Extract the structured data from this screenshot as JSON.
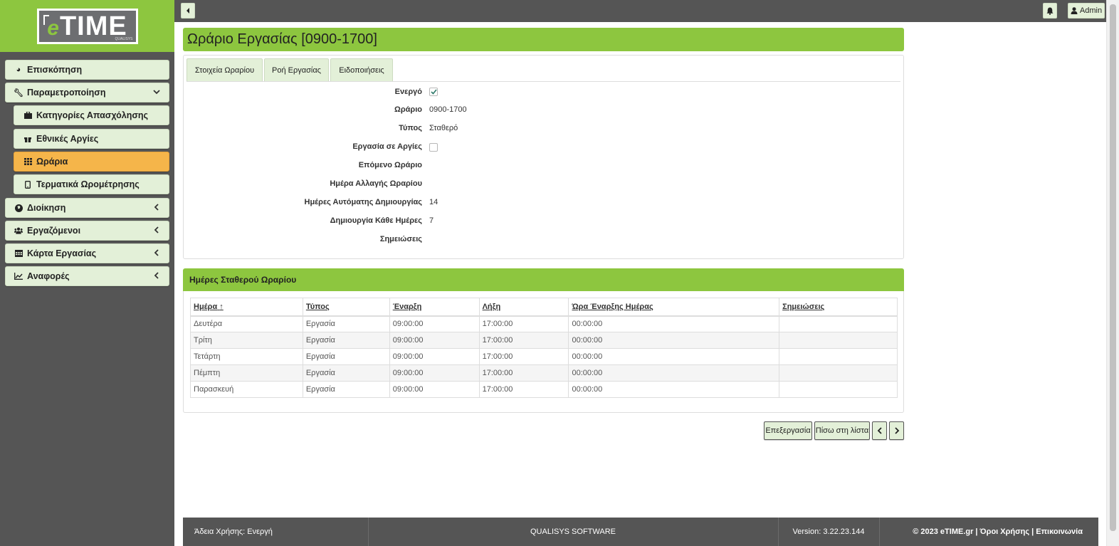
{
  "app": {
    "logo_text": "TIME",
    "logo_prefix": "e",
    "logo_sub": "QUALISYS"
  },
  "sidebar": {
    "items": [
      {
        "label": "Επισκόπηση",
        "icon": "pie-chart-icon"
      },
      {
        "label": "Παραμετροποίηση",
        "icon": "wrench-icon"
      },
      {
        "label": "Κατηγορίες Απασχόλησης",
        "icon": "briefcase-icon"
      },
      {
        "label": "Εθνικές Αργίες",
        "icon": "gift-icon"
      },
      {
        "label": "Ωράρια",
        "icon": "grid-icon"
      },
      {
        "label": "Τερματικά Ωρομέτρησης",
        "icon": "mobile-icon"
      },
      {
        "label": "Διοίκηση",
        "icon": "globe-icon"
      },
      {
        "label": "Εργαζόμενοι",
        "icon": "users-icon"
      },
      {
        "label": "Κάρτα Εργασίας",
        "icon": "calendar-icon"
      },
      {
        "label": "Αναφορές",
        "icon": "line-chart-icon"
      }
    ]
  },
  "topbar": {
    "admin_label": "Admin"
  },
  "page": {
    "title": "Ωράριο Εργασίας [0900-1700]"
  },
  "tabs": [
    {
      "label": "Στοιχεία Ωραρίου"
    },
    {
      "label": "Ροή Εργασίας"
    },
    {
      "label": "Ειδοποιήσεις"
    }
  ],
  "details": {
    "active_label": "Ενεργό",
    "active_value": true,
    "schedule_label": "Ωράριο",
    "schedule_value": "0900-1700",
    "type_label": "Τύπος",
    "type_value": "Σταθερό",
    "work_holidays_label": "Εργασία σε Αργίες",
    "work_holidays_value": false,
    "next_schedule_label": "Επόμενο Ωράριο",
    "change_day_label": "Ημέρα Αλλαγής Ωραρίου",
    "auto_days_label": "Ημέρες Αυτόματης Δημιουργίας",
    "auto_days_value": "14",
    "every_days_label": "Δημιουργία Κάθε Ημέρες",
    "every_days_value": "7",
    "notes_label": "Σημειώσεις"
  },
  "days_section": {
    "title": "Ημέρες Σταθερού Ωραρίου",
    "columns": [
      "Ημέρα",
      "Τύπος",
      "Έναρξη",
      "Λήξη",
      "Ώρα Έναρξης Ημέρας",
      "Σημειώσεις"
    ],
    "rows": [
      [
        "Δευτέρα",
        "Εργασία",
        "09:00:00",
        "17:00:00",
        "00:00:00",
        ""
      ],
      [
        "Τρίτη",
        "Εργασία",
        "09:00:00",
        "17:00:00",
        "00:00:00",
        ""
      ],
      [
        "Τετάρτη",
        "Εργασία",
        "09:00:00",
        "17:00:00",
        "00:00:00",
        ""
      ],
      [
        "Πέμπτη",
        "Εργασία",
        "09:00:00",
        "17:00:00",
        "00:00:00",
        ""
      ],
      [
        "Παρασκευή",
        "Εργασία",
        "09:00:00",
        "17:00:00",
        "00:00:00",
        ""
      ]
    ],
    "sort_indicator": "↑"
  },
  "actions": {
    "edit_label": "Επεξεργασία",
    "back_label": "Πίσω στη λίστα",
    "prev_label": "‹",
    "next_label": "›"
  },
  "footer": {
    "license": "Άδεια Χρήσης: Ενεργή",
    "company": "QUALISYS SOFTWARE",
    "version": "Version: 3.22.23.144",
    "copyright": "© 2023 eTIME.gr | Όροι Χρήσης | Επικοινωνία"
  },
  "colors": {
    "brand_green": "#8dc63f",
    "menu_bg": "#e3f0d8",
    "active_orange": "#f5b54a",
    "dark": "#555555"
  }
}
